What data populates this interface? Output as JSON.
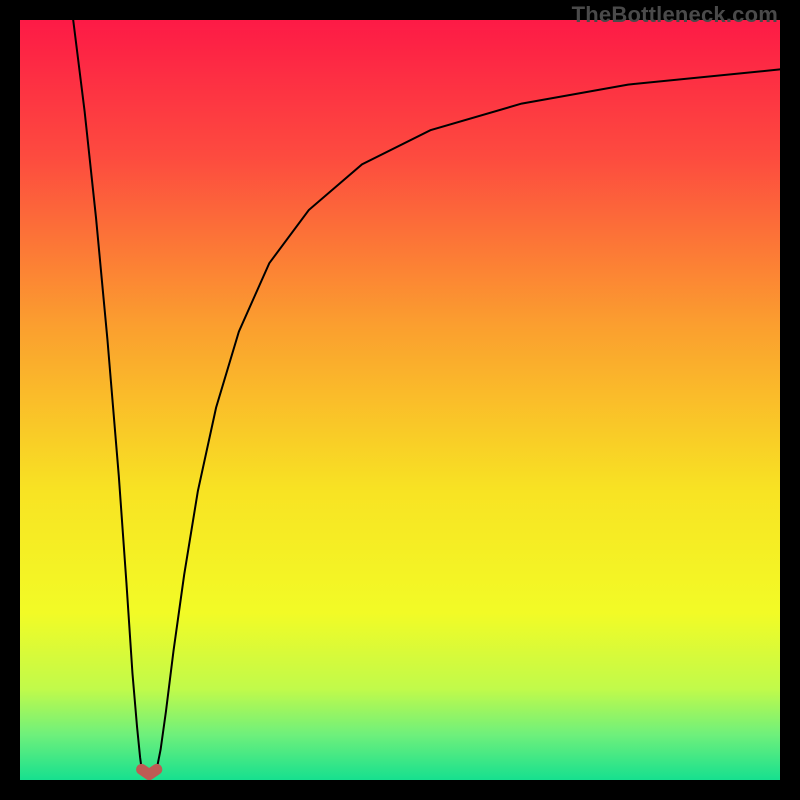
{
  "watermark": "TheBottleneck.com",
  "chart_data": {
    "type": "line",
    "title": "",
    "xlabel": "",
    "ylabel": "",
    "xlim": [
      0,
      100
    ],
    "ylim": [
      0,
      100
    ],
    "grid": false,
    "background_gradient": {
      "direction": "vertical",
      "stops": [
        {
          "pct": 0,
          "color": "#fd1a46"
        },
        {
          "pct": 18,
          "color": "#fd4b3f"
        },
        {
          "pct": 40,
          "color": "#fb9e2f"
        },
        {
          "pct": 62,
          "color": "#f8e323"
        },
        {
          "pct": 78,
          "color": "#f2fb26"
        },
        {
          "pct": 88,
          "color": "#c1fa4a"
        },
        {
          "pct": 94,
          "color": "#6ff07b"
        },
        {
          "pct": 100,
          "color": "#16e08f"
        }
      ]
    },
    "series": [
      {
        "name": "left-branch",
        "type": "line",
        "color": "#000000",
        "width": 2,
        "x": [
          7.0,
          8.5,
          10.0,
          11.5,
          13.0,
          14.0,
          14.8,
          15.4,
          15.8,
          16.0
        ],
        "y": [
          100.0,
          88.0,
          74.0,
          58.0,
          40.0,
          26.0,
          14.0,
          7.0,
          3.0,
          1.5
        ]
      },
      {
        "name": "right-branch",
        "type": "line",
        "color": "#000000",
        "width": 2,
        "x": [
          18.0,
          18.5,
          19.2,
          20.2,
          21.6,
          23.4,
          25.8,
          28.8,
          32.8,
          38.0,
          45.0,
          54.0,
          66.0,
          80.0,
          100.0
        ],
        "y": [
          1.5,
          4.0,
          9.0,
          17.0,
          27.0,
          38.0,
          49.0,
          59.0,
          68.0,
          75.0,
          81.0,
          85.5,
          89.0,
          91.5,
          93.5
        ]
      },
      {
        "name": "dip-marker",
        "type": "marker",
        "color": "#bd5b54",
        "x": [
          16.0,
          17.0,
          18.0
        ],
        "y": [
          1.4,
          0.7,
          1.4
        ]
      }
    ]
  }
}
